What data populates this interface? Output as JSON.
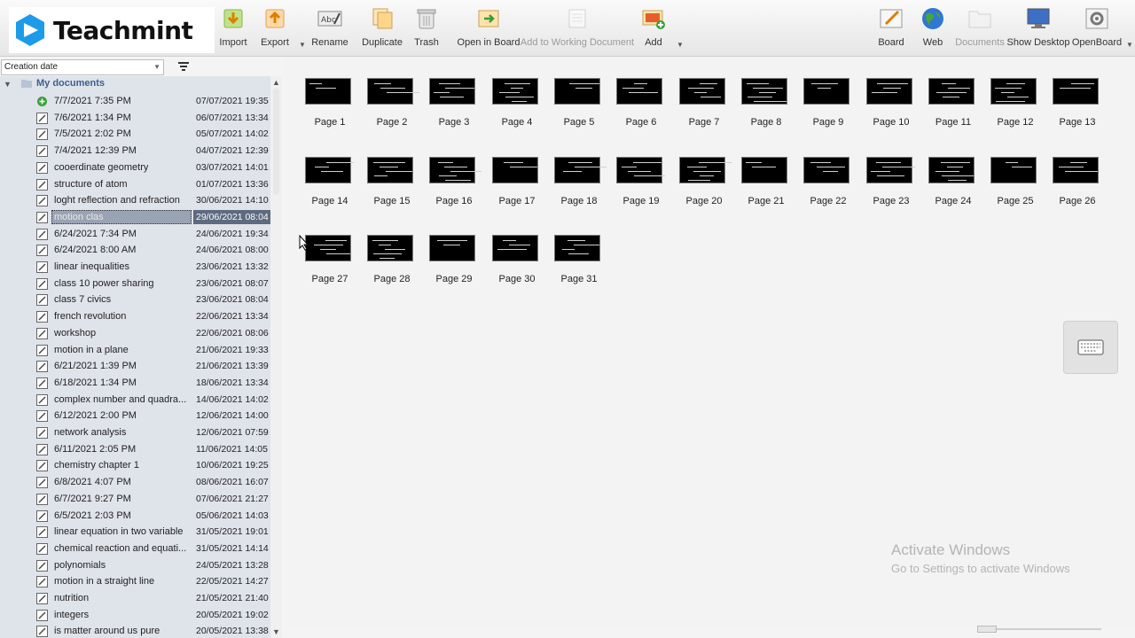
{
  "app": {
    "brand_name": "Teachmint"
  },
  "toolbar": {
    "tools": [
      {
        "id": "import",
        "label": "Import",
        "icon": "import-icon",
        "enabled": true
      },
      {
        "id": "export",
        "label": "Export",
        "icon": "export-icon",
        "enabled": true
      },
      {
        "id": "rename",
        "label": "Rename",
        "icon": "rename-icon",
        "enabled": true
      },
      {
        "id": "duplicate",
        "label": "Duplicate",
        "icon": "duplicate-icon",
        "enabled": true
      },
      {
        "id": "trash",
        "label": "Trash",
        "icon": "trash-icon",
        "enabled": true
      },
      {
        "id": "open-in-board",
        "label": "Open in Board",
        "icon": "open-in-board-icon",
        "enabled": true
      },
      {
        "id": "add-to-working-document",
        "label": "Add to Working Document",
        "icon": "add-to-working-document-icon",
        "enabled": false
      },
      {
        "id": "add",
        "label": "Add",
        "icon": "add-icon",
        "enabled": true
      },
      {
        "id": "board",
        "label": "Board",
        "icon": "board-icon",
        "enabled": true
      },
      {
        "id": "web",
        "label": "Web",
        "icon": "web-globe-icon",
        "enabled": true
      },
      {
        "id": "documents",
        "label": "Documents",
        "icon": "documents-folder-icon",
        "enabled": false
      },
      {
        "id": "show-desktop",
        "label": "Show Desktop",
        "icon": "show-desktop-icon",
        "enabled": true
      },
      {
        "id": "openboard",
        "label": "OpenBoard",
        "icon": "openboard-settings-icon",
        "enabled": true
      }
    ]
  },
  "sidebar": {
    "sort_value": "Creation date",
    "root_label": "My documents",
    "items": [
      {
        "name": "7/7/2021 7:35 PM",
        "date": "07/07/2021 19:35",
        "current": true
      },
      {
        "name": "7/6/2021 1:34 PM",
        "date": "06/07/2021 13:34"
      },
      {
        "name": "7/5/2021 2:02 PM",
        "date": "05/07/2021 14:02"
      },
      {
        "name": "7/4/2021 12:39 PM",
        "date": "04/07/2021 12:39"
      },
      {
        "name": "cooerdinate geometry",
        "date": "03/07/2021 14:01"
      },
      {
        "name": "structure of atom",
        "date": "01/07/2021 13:36"
      },
      {
        "name": "loght reflection and refraction",
        "date": "30/06/2021 14:10"
      },
      {
        "name": "motion clas",
        "date": "29/06/2021 08:04",
        "selected": true
      },
      {
        "name": "6/24/2021 7:34 PM",
        "date": "24/06/2021 19:34"
      },
      {
        "name": "6/24/2021 8:00 AM",
        "date": "24/06/2021 08:00"
      },
      {
        "name": "linear inequalities",
        "date": "23/06/2021 13:32"
      },
      {
        "name": "class 10 power sharing",
        "date": "23/06/2021 08:07"
      },
      {
        "name": "class 7 civics",
        "date": "23/06/2021 08:04"
      },
      {
        "name": "french revolution",
        "date": "22/06/2021 13:34"
      },
      {
        "name": "workshop",
        "date": "22/06/2021 08:06"
      },
      {
        "name": "motion in a plane",
        "date": "21/06/2021 19:33"
      },
      {
        "name": "6/21/2021 1:39 PM",
        "date": "21/06/2021 13:39"
      },
      {
        "name": "6/18/2021 1:34 PM",
        "date": "18/06/2021 13:34"
      },
      {
        "name": "complex number and quadra...",
        "date": "14/06/2021 14:02"
      },
      {
        "name": "6/12/2021 2:00 PM",
        "date": "12/06/2021 14:00"
      },
      {
        "name": "network analysis",
        "date": "12/06/2021 07:59"
      },
      {
        "name": "6/11/2021 2:05 PM",
        "date": "11/06/2021 14:05"
      },
      {
        "name": "chemistry chapter 1",
        "date": "10/06/2021 19:25"
      },
      {
        "name": "6/8/2021 4:07 PM",
        "date": "08/06/2021 16:07"
      },
      {
        "name": "6/7/2021 9:27 PM",
        "date": "07/06/2021 21:27"
      },
      {
        "name": "6/5/2021 2:03 PM",
        "date": "05/06/2021 14:03"
      },
      {
        "name": "linear equation in two variable",
        "date": "31/05/2021 19:01"
      },
      {
        "name": "chemical reaction and equati...",
        "date": "31/05/2021 14:14"
      },
      {
        "name": "polynomials",
        "date": "24/05/2021 13:28"
      },
      {
        "name": "motion in a straight line",
        "date": "22/05/2021 14:27"
      },
      {
        "name": "nutrition",
        "date": "21/05/2021 21:40"
      },
      {
        "name": "integers",
        "date": "20/05/2021 19:02"
      },
      {
        "name": "is matter around us pure",
        "date": "20/05/2021 13:38"
      }
    ]
  },
  "pages": [
    "Page 1",
    "Page 2",
    "Page 3",
    "Page 4",
    "Page 5",
    "Page 6",
    "Page 7",
    "Page 8",
    "Page 9",
    "Page 10",
    "Page 11",
    "Page 12",
    "Page 13",
    "Page 14",
    "Page 15",
    "Page 16",
    "Page 17",
    "Page 18",
    "Page 19",
    "Page 20",
    "Page 21",
    "Page 22",
    "Page 23",
    "Page 24",
    "Page 25",
    "Page 26",
    "Page 27",
    "Page 28",
    "Page 29",
    "Page 30",
    "Page 31"
  ],
  "watermark": {
    "title": "Activate Windows",
    "subtitle": "Go to Settings to activate Windows"
  },
  "colors": {
    "accent": "#3d5f93",
    "selection": "#5d6a80",
    "logo_blue": "#1e9be8"
  }
}
